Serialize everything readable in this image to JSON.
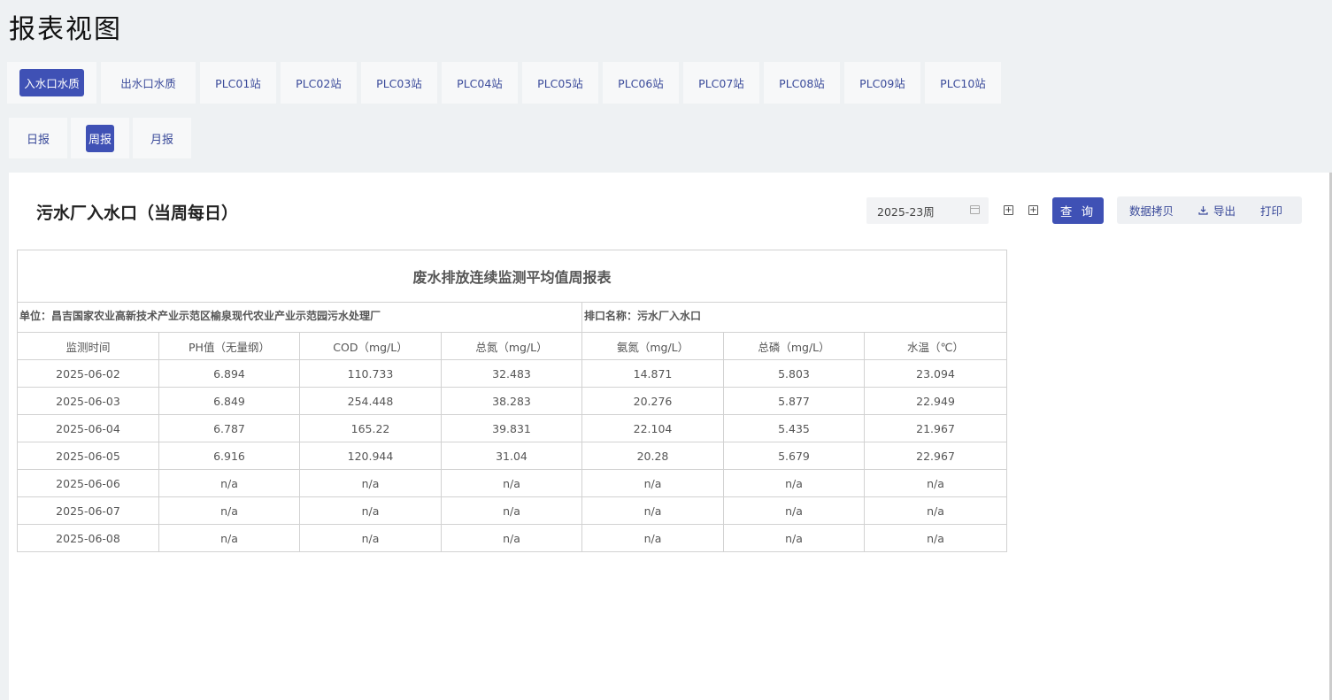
{
  "page": {
    "title": "报表视图"
  },
  "site_tabs": [
    {
      "label": "入水口水质",
      "active": true
    },
    {
      "label": "出水口水质",
      "active": false
    },
    {
      "label": "PLC01站",
      "active": false
    },
    {
      "label": "PLC02站",
      "active": false
    },
    {
      "label": "PLC03站",
      "active": false
    },
    {
      "label": "PLC04站",
      "active": false
    },
    {
      "label": "PLC05站",
      "active": false
    },
    {
      "label": "PLC06站",
      "active": false
    },
    {
      "label": "PLC07站",
      "active": false
    },
    {
      "label": "PLC08站",
      "active": false
    },
    {
      "label": "PLC09站",
      "active": false
    },
    {
      "label": "PLC10站",
      "active": false
    }
  ],
  "period_tabs": [
    {
      "label": "日报",
      "active": false
    },
    {
      "label": "周报",
      "active": true
    },
    {
      "label": "月报",
      "active": false
    }
  ],
  "report": {
    "heading": "污水厂入水口（当周每日）",
    "date_value": "2025-23周",
    "query_label": "查 询",
    "copy_label": "数据拷贝",
    "export_label": "导出",
    "print_label": "打印"
  },
  "table": {
    "title": "废水排放连续监测平均值周报表",
    "unit": "单位：昌吉国家农业高新技术产业示范区榆泉现代农业产业示范园污水处理厂",
    "outlet": "排口名称：污水厂入水口",
    "headers": [
      "监测时间",
      "PH值（无量纲）",
      "COD（mg/L）",
      "总氮（mg/L）",
      "氨氮（mg/L）",
      "总磷（mg/L）",
      "水温（℃）"
    ],
    "rows": [
      [
        "2025-06-02",
        "6.894",
        "110.733",
        "32.483",
        "14.871",
        "5.803",
        "23.094"
      ],
      [
        "2025-06-03",
        "6.849",
        "254.448",
        "38.283",
        "20.276",
        "5.877",
        "22.949"
      ],
      [
        "2025-06-04",
        "6.787",
        "165.22",
        "39.831",
        "22.104",
        "5.435",
        "21.967"
      ],
      [
        "2025-06-05",
        "6.916",
        "120.944",
        "31.04",
        "20.28",
        "5.679",
        "22.967"
      ],
      [
        "2025-06-06",
        "n/a",
        "n/a",
        "n/a",
        "n/a",
        "n/a",
        "n/a"
      ],
      [
        "2025-06-07",
        "n/a",
        "n/a",
        "n/a",
        "n/a",
        "n/a",
        "n/a"
      ],
      [
        "2025-06-08",
        "n/a",
        "n/a",
        "n/a",
        "n/a",
        "n/a",
        "n/a"
      ]
    ]
  },
  "colors": {
    "accent": "#3f51b5",
    "background": "#eef1f3"
  }
}
